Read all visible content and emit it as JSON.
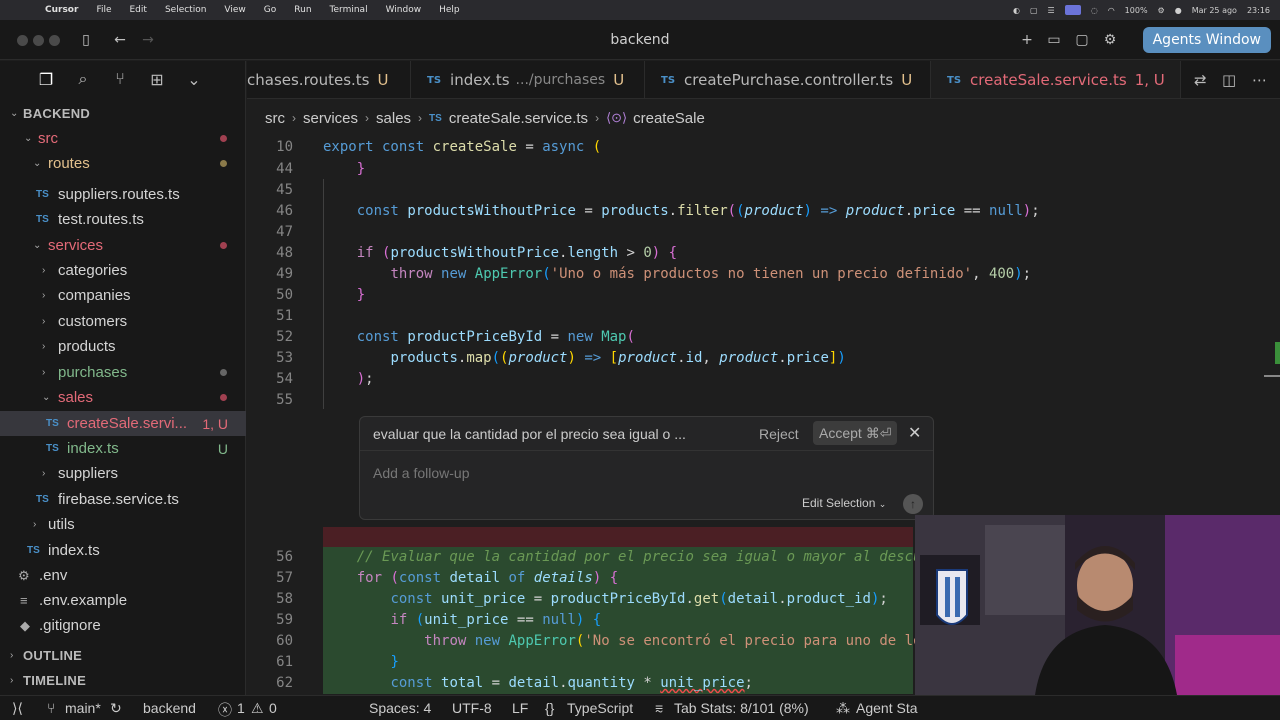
{
  "menubar": {
    "app": "Cursor",
    "items": [
      "File",
      "Edit",
      "Selection",
      "View",
      "Go",
      "Run",
      "Terminal",
      "Window",
      "Help"
    ],
    "battery": "100%",
    "date": "Mar 25 ago",
    "time": "23:16"
  },
  "window": {
    "title": "backend",
    "agents_button": "Agents Window"
  },
  "tabs": [
    {
      "prefix": "",
      "name": "chases.routes.ts",
      "path": "",
      "status": "U"
    },
    {
      "prefix": "TS",
      "name": "index.ts",
      "path": ".../purchases",
      "status": "U"
    },
    {
      "prefix": "TS",
      "name": "createPurchase.controller.ts",
      "path": "",
      "status": "U"
    },
    {
      "prefix": "TS",
      "name": "createSale.service.ts",
      "path": "",
      "status": "1, U"
    }
  ],
  "breadcrumb": {
    "items": [
      "src",
      "services",
      "sales"
    ],
    "file_prefix": "TS",
    "file": "createSale.service.ts",
    "symbol": "createSale"
  },
  "explorer": {
    "root": "BACKEND",
    "rows": [
      {
        "label": "src",
        "type": "folder-open"
      },
      {
        "label": "routes",
        "type": "folder-open"
      },
      {
        "label": "suppliers.routes.ts",
        "type": "file",
        "prefix": "TS"
      },
      {
        "label": "test.routes.ts",
        "type": "file",
        "prefix": "TS"
      },
      {
        "label": "services",
        "type": "folder-open"
      },
      {
        "label": "categories",
        "type": "folder"
      },
      {
        "label": "companies",
        "type": "folder"
      },
      {
        "label": "customers",
        "type": "folder"
      },
      {
        "label": "products",
        "type": "folder"
      },
      {
        "label": "purchases",
        "type": "folder"
      },
      {
        "label": "sales",
        "type": "folder-open"
      },
      {
        "label": "createSale.servi...",
        "type": "file",
        "prefix": "TS",
        "badge": "1, U"
      },
      {
        "label": "index.ts",
        "type": "file",
        "prefix": "TS",
        "badge": "U"
      },
      {
        "label": "suppliers",
        "type": "folder"
      },
      {
        "label": "firebase.service.ts",
        "type": "file",
        "prefix": "TS"
      },
      {
        "label": "utils",
        "type": "folder"
      },
      {
        "label": "index.ts",
        "type": "file",
        "prefix": "TS"
      },
      {
        "label": ".env",
        "type": "file"
      },
      {
        "label": ".env.example",
        "type": "file"
      },
      {
        "label": ".gitignore",
        "type": "file"
      }
    ],
    "outline": "OUTLINE",
    "timeline": "TIMELINE"
  },
  "editor": {
    "line_numbers": [
      "10",
      "44",
      "45",
      "46",
      "47",
      "48",
      "49",
      "50",
      "51",
      "52",
      "53",
      "54",
      "55",
      "56",
      "57",
      "58",
      "59",
      "60",
      "61",
      "62"
    ],
    "sticky_line": "export const createSale = async (",
    "comment_line": "// Evaluar que la cantidad por el precio sea igual o mayor al descu",
    "error_message": "'Uno o más productos no tienen un precio definido'",
    "error_message_2": "'No se encontró el precio para uno de los"
  },
  "inline_edit": {
    "query": "evaluar que la cantidad por el precio sea igual o ...",
    "reject": "Reject",
    "accept": "Accept ⌘⏎",
    "followup_placeholder": "Add a follow-up",
    "mode": "Edit Selection"
  },
  "statusbar": {
    "branch": "main*",
    "workspace": "backend",
    "errors": "1",
    "warnings": "0",
    "spaces": "Spaces: 4",
    "encoding": "UTF-8",
    "eol": "LF",
    "language": "TypeScript",
    "tab_stats": "Tab Stats: 8/101 (8%)",
    "agent": "Agent Sta"
  }
}
